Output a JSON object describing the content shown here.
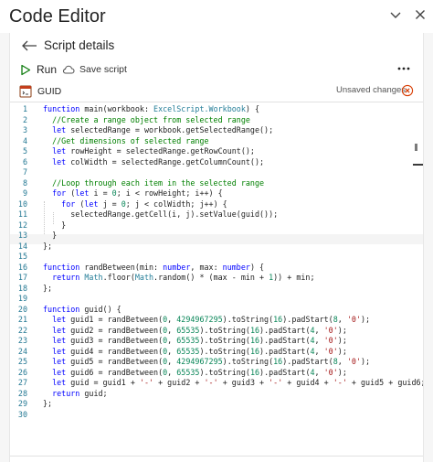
{
  "window": {
    "title": "Code Editor"
  },
  "header": {
    "title": "Script details"
  },
  "toolbar": {
    "run_label": "Run",
    "save_label": "Save script"
  },
  "script": {
    "name": "GUID",
    "status": "Unsaved changes"
  },
  "editor": {
    "lines": [
      {
        "n": "1",
        "tokens": [
          [
            "kw",
            "function "
          ],
          [
            "pl",
            "main(workbook: "
          ],
          [
            "ty",
            "ExcelScript.Workbook"
          ],
          [
            "pl",
            ") {"
          ]
        ]
      },
      {
        "n": "2",
        "tokens": [
          [
            "cm",
            "  //Create a range object from selected range"
          ]
        ]
      },
      {
        "n": "3",
        "tokens": [
          [
            "kw",
            "  let "
          ],
          [
            "pl",
            "selectedRange = workbook.getSelectedRange();"
          ]
        ]
      },
      {
        "n": "4",
        "tokens": [
          [
            "cm",
            "  //Get dimensions of selected range"
          ]
        ]
      },
      {
        "n": "5",
        "tokens": [
          [
            "kw",
            "  let "
          ],
          [
            "pl",
            "rowHeight = selectedRange.getRowCount();"
          ]
        ]
      },
      {
        "n": "6",
        "tokens": [
          [
            "kw",
            "  let "
          ],
          [
            "pl",
            "colWidth = selectedRange.getColumnCount();"
          ]
        ]
      },
      {
        "n": "7",
        "tokens": []
      },
      {
        "n": "8",
        "tokens": [
          [
            "cm",
            "  //Loop through each item in the selected range"
          ]
        ]
      },
      {
        "n": "9",
        "tokens": [
          [
            "kw",
            "  for "
          ],
          [
            "pl",
            "("
          ],
          [
            "kw",
            "let "
          ],
          [
            "pl",
            "i = "
          ],
          [
            "nm",
            "0"
          ],
          [
            "pl",
            "; i < rowHeight; i++) {"
          ]
        ]
      },
      {
        "n": "10",
        "tokens": [
          [
            "kw",
            "    for "
          ],
          [
            "pl",
            "("
          ],
          [
            "kw",
            "let "
          ],
          [
            "pl",
            "j = "
          ],
          [
            "nm",
            "0"
          ],
          [
            "pl",
            "; j < colWidth; j++) {"
          ]
        ]
      },
      {
        "n": "11",
        "tokens": [
          [
            "pl",
            "      selectedRange.getCell(i, j).setValue(guid());"
          ]
        ]
      },
      {
        "n": "12",
        "tokens": [
          [
            "pl",
            "    }"
          ]
        ]
      },
      {
        "n": "13",
        "tokens": [
          [
            "pl",
            "  }"
          ]
        ]
      },
      {
        "n": "14",
        "tokens": [
          [
            "pl",
            "};"
          ]
        ]
      },
      {
        "n": "15",
        "tokens": []
      },
      {
        "n": "16",
        "tokens": [
          [
            "kw",
            "function "
          ],
          [
            "pl",
            "randBetween(min: "
          ],
          [
            "kw",
            "number"
          ],
          [
            "pl",
            ", max: "
          ],
          [
            "kw",
            "number"
          ],
          [
            "pl",
            ") {"
          ]
        ]
      },
      {
        "n": "17",
        "tokens": [
          [
            "kw",
            "  return "
          ],
          [
            "ty",
            "Math"
          ],
          [
            "pl",
            ".floor("
          ],
          [
            "ty",
            "Math"
          ],
          [
            "pl",
            ".random() * (max - min + "
          ],
          [
            "nm",
            "1"
          ],
          [
            "pl",
            ")) + min;"
          ]
        ]
      },
      {
        "n": "18",
        "tokens": [
          [
            "pl",
            "};"
          ]
        ]
      },
      {
        "n": "19",
        "tokens": []
      },
      {
        "n": "20",
        "tokens": [
          [
            "kw",
            "function "
          ],
          [
            "pl",
            "guid() {"
          ]
        ]
      },
      {
        "n": "21",
        "tokens": [
          [
            "kw",
            "  let "
          ],
          [
            "pl",
            "guid1 = randBetween("
          ],
          [
            "nm",
            "0"
          ],
          [
            "pl",
            ", "
          ],
          [
            "nm",
            "4294967295"
          ],
          [
            "pl",
            ").toString("
          ],
          [
            "nm",
            "16"
          ],
          [
            "pl",
            ").padStart("
          ],
          [
            "nm",
            "8"
          ],
          [
            "pl",
            ", "
          ],
          [
            "st",
            "'0'"
          ],
          [
            "pl",
            ");"
          ]
        ]
      },
      {
        "n": "22",
        "tokens": [
          [
            "kw",
            "  let "
          ],
          [
            "pl",
            "guid2 = randBetween("
          ],
          [
            "nm",
            "0"
          ],
          [
            "pl",
            ", "
          ],
          [
            "nm",
            "65535"
          ],
          [
            "pl",
            ").toString("
          ],
          [
            "nm",
            "16"
          ],
          [
            "pl",
            ").padStart("
          ],
          [
            "nm",
            "4"
          ],
          [
            "pl",
            ", "
          ],
          [
            "st",
            "'0'"
          ],
          [
            "pl",
            ");"
          ]
        ]
      },
      {
        "n": "23",
        "tokens": [
          [
            "kw",
            "  let "
          ],
          [
            "pl",
            "guid3 = randBetween("
          ],
          [
            "nm",
            "0"
          ],
          [
            "pl",
            ", "
          ],
          [
            "nm",
            "65535"
          ],
          [
            "pl",
            ").toString("
          ],
          [
            "nm",
            "16"
          ],
          [
            "pl",
            ").padStart("
          ],
          [
            "nm",
            "4"
          ],
          [
            "pl",
            ", "
          ],
          [
            "st",
            "'0'"
          ],
          [
            "pl",
            ");"
          ]
        ]
      },
      {
        "n": "24",
        "tokens": [
          [
            "kw",
            "  let "
          ],
          [
            "pl",
            "guid4 = randBetween("
          ],
          [
            "nm",
            "0"
          ],
          [
            "pl",
            ", "
          ],
          [
            "nm",
            "65535"
          ],
          [
            "pl",
            ").toString("
          ],
          [
            "nm",
            "16"
          ],
          [
            "pl",
            ").padStart("
          ],
          [
            "nm",
            "4"
          ],
          [
            "pl",
            ", "
          ],
          [
            "st",
            "'0'"
          ],
          [
            "pl",
            ");"
          ]
        ]
      },
      {
        "n": "25",
        "tokens": [
          [
            "kw",
            "  let "
          ],
          [
            "pl",
            "guid5 = randBetween("
          ],
          [
            "nm",
            "0"
          ],
          [
            "pl",
            ", "
          ],
          [
            "nm",
            "4294967295"
          ],
          [
            "pl",
            ").toString("
          ],
          [
            "nm",
            "16"
          ],
          [
            "pl",
            ").padStart("
          ],
          [
            "nm",
            "8"
          ],
          [
            "pl",
            ", "
          ],
          [
            "st",
            "'0'"
          ],
          [
            "pl",
            ");"
          ]
        ]
      },
      {
        "n": "26",
        "tokens": [
          [
            "kw",
            "  let "
          ],
          [
            "pl",
            "guid6 = randBetween("
          ],
          [
            "nm",
            "0"
          ],
          [
            "pl",
            ", "
          ],
          [
            "nm",
            "65535"
          ],
          [
            "pl",
            ").toString("
          ],
          [
            "nm",
            "16"
          ],
          [
            "pl",
            ").padStart("
          ],
          [
            "nm",
            "4"
          ],
          [
            "pl",
            ", "
          ],
          [
            "st",
            "'0'"
          ],
          [
            "pl",
            ");"
          ]
        ]
      },
      {
        "n": "27",
        "tokens": [
          [
            "kw",
            "  let "
          ],
          [
            "pl",
            "guid = guid1 + "
          ],
          [
            "st",
            "'-'"
          ],
          [
            "pl",
            " + guid2 + "
          ],
          [
            "st",
            "'-'"
          ],
          [
            "pl",
            " + guid3 + "
          ],
          [
            "st",
            "'-'"
          ],
          [
            "pl",
            " + guid4 + "
          ],
          [
            "st",
            "'-'"
          ],
          [
            "pl",
            " + guid5 + guid6;"
          ]
        ]
      },
      {
        "n": "28",
        "tokens": [
          [
            "kw",
            "  return "
          ],
          [
            "pl",
            "guid;"
          ]
        ]
      },
      {
        "n": "29",
        "tokens": [
          [
            "pl",
            "};"
          ]
        ]
      },
      {
        "n": "30",
        "tokens": []
      }
    ]
  },
  "colors": {
    "keyword": "#0000ff",
    "comment": "#008000",
    "type": "#267f99",
    "number": "#098658",
    "string": "#a31515",
    "line_number": "#237893",
    "accent": "#0f6cbd",
    "run_icon": "#107c10",
    "discard_icon": "#d83b01"
  },
  "icons": {
    "chevron": "chevron-down-icon",
    "close": "close-icon",
    "back": "back-arrow-icon",
    "run": "play-icon",
    "save": "cloud-save-icon",
    "more": "more-icon",
    "script": "script-icon",
    "discard": "discard-icon"
  }
}
